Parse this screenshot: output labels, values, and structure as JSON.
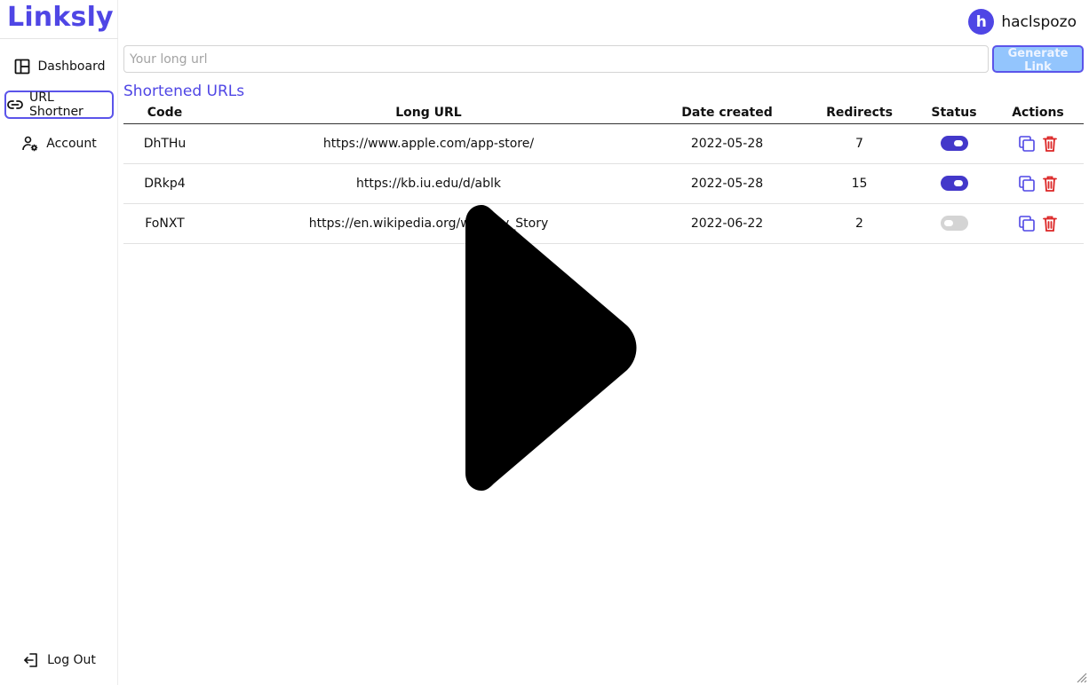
{
  "app": {
    "name": "Linksly"
  },
  "user": {
    "initial": "h",
    "name": "haclspozo"
  },
  "sidebar": {
    "items": [
      {
        "label": "Dashboard",
        "icon": "layout-icon"
      },
      {
        "label": "URL Shortner",
        "icon": "link-icon",
        "active": true
      },
      {
        "label": "Account",
        "icon": "user-cog-icon"
      }
    ],
    "logout": {
      "label": "Log Out",
      "icon": "logout-icon"
    }
  },
  "shortener": {
    "input_placeholder": "Your long url",
    "input_value": "",
    "generate_label": "Generate Link"
  },
  "table": {
    "title": "Shortened URLs",
    "columns": [
      "Code",
      "Long URL",
      "Date created",
      "Redirects",
      "Status",
      "Actions"
    ],
    "rows": [
      {
        "code": "DhTHu",
        "long_url": "https://www.apple.com/app-store/",
        "date": "2022-05-28",
        "redirects": "7",
        "status": true
      },
      {
        "code": "DRkp4",
        "long_url": "https://kb.iu.edu/d/ablk",
        "date": "2022-05-28",
        "redirects": "15",
        "status": true
      },
      {
        "code": "FoNXT",
        "long_url": "https://en.wikipedia.org/wiki/Toy_Story",
        "date": "2022-06-22",
        "redirects": "2",
        "status": false
      }
    ]
  },
  "colors": {
    "brand": "#4f46e5",
    "toggle_on": "#4338ca",
    "toggle_off": "#d4d4d4",
    "delete": "#dc2626",
    "copy": "#4f46e5",
    "button_bg": "#93c5fd"
  },
  "overlay": {
    "icon": "play-icon"
  }
}
